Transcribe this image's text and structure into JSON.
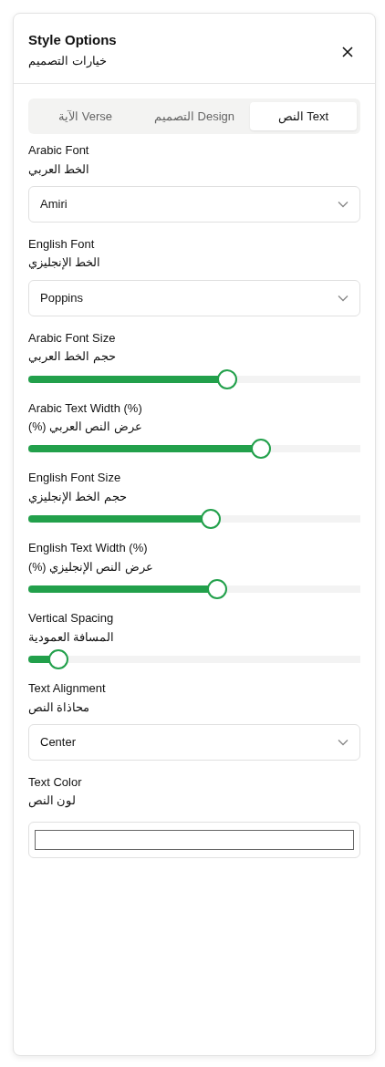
{
  "panel": {
    "title": "Style Options",
    "subtitle": "خيارات التصميم"
  },
  "tabs": [
    {
      "label": "النص Text",
      "selected": true
    },
    {
      "label": "التصميم Design",
      "selected": false
    },
    {
      "label": "الآية Verse",
      "selected": false
    }
  ],
  "fields": [
    {
      "kind": "select",
      "label": "Arabic Font",
      "label_ar": "الخط العربي",
      "value": "Amiri"
    },
    {
      "kind": "select",
      "label": "English Font",
      "label_ar": "الخط الإنجليزي",
      "value": "Poppins"
    },
    {
      "kind": "slider",
      "label": "Arabic Font Size",
      "label_ar": "حجم الخط العربي",
      "level": 0.6
    },
    {
      "kind": "slider",
      "label": "Arabic Text Width (%)",
      "label_ar": "عرض النص العربي (%)",
      "level": 0.7
    },
    {
      "kind": "slider",
      "label": "English Font Size",
      "label_ar": "حجم الخط الإنجليزي",
      "level": 0.55
    },
    {
      "kind": "slider",
      "label": "English Text Width (%)",
      "label_ar": "عرض النص الإنجليزي (%)",
      "level": 0.57
    },
    {
      "kind": "slider",
      "label": "Vertical Spacing",
      "label_ar": "المسافة العمودية",
      "level": 0.09
    },
    {
      "kind": "select",
      "label": "Text Alignment",
      "label_ar": "محاذاة النص",
      "value": "Center"
    },
    {
      "kind": "color",
      "label": "Text Color",
      "label_ar": "لون النص"
    }
  ]
}
